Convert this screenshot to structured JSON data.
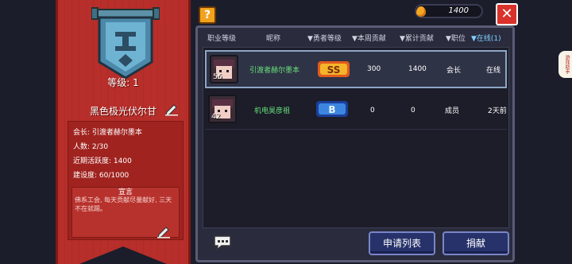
{
  "banner": {
    "level_label": "等级: 1",
    "guild_name": "黑色极光伏尔甘",
    "info_lines": [
      "会长: 引渡者赫尔墨本",
      "人数: 2/30",
      "近期活跃度: 1400",
      "建设度: 60/1000"
    ],
    "declaration_title": "宣言",
    "declaration_text": "佛系工会, 每天贡献尽量献好, 三天不在就踢。"
  },
  "topbar": {
    "help_label": "?",
    "coins": "1400",
    "close_label": "✕"
  },
  "table": {
    "headers": [
      "职业等级",
      "昵称",
      "▼勇者等级",
      "▼本周贡献",
      "▼累计贡献",
      "▼职位",
      "▼在线(1)"
    ],
    "rows": [
      {
        "level": "56",
        "name": "引渡者赫尔墨本",
        "rank_badge": "SS",
        "weekly": "300",
        "total": "1400",
        "position": "会长",
        "online": "在线",
        "selected": true
      },
      {
        "level": "42",
        "name": "机电昊彦祖",
        "rank_badge": "B",
        "weekly": "0",
        "total": "0",
        "position": "成员",
        "online": "2天前",
        "selected": false
      }
    ]
  },
  "buttons": {
    "apply_list": "申请列表",
    "donate": "捐献"
  },
  "side_tab": "游戏助手",
  "colors": {
    "banner_red": "#b72e2a",
    "panel_bg": "#2a2c3e",
    "name_green": "#67e07a",
    "sorted_header": "#7fd0ff",
    "button_blue": "#27326a"
  }
}
